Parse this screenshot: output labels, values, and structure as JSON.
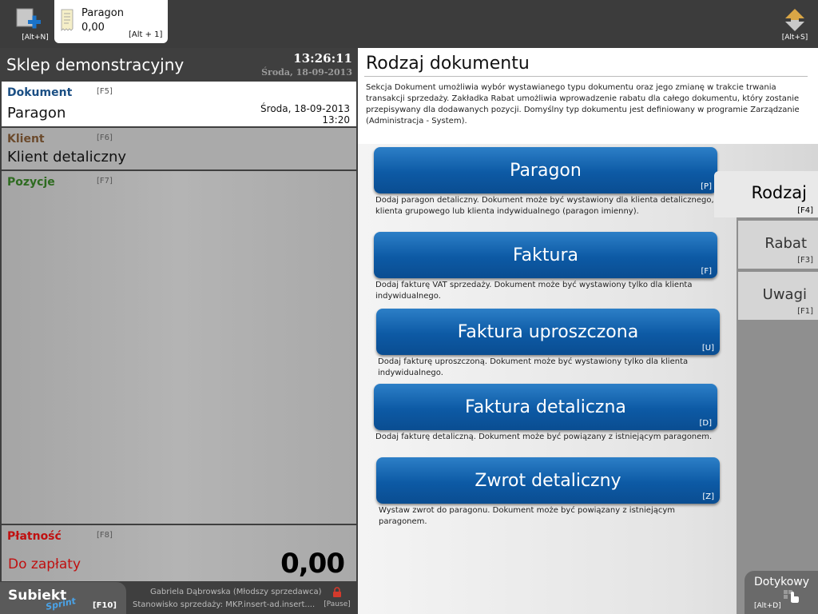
{
  "topbar": {
    "new_kbd": "[Alt+N]",
    "doc_tab": {
      "name": "Paragon",
      "amount": "0,00",
      "kbd": "[Alt + 1]"
    },
    "switch_kbd": "[Alt+S]"
  },
  "store": {
    "name": "Sklep demonstracyjny",
    "time": "13:26:11",
    "date": "Środa, 18-09-2013"
  },
  "sections": {
    "document": {
      "title": "Dokument",
      "key": "[F5]",
      "value": "Paragon",
      "date": "Środa, 18-09-2013",
      "time": "13:20"
    },
    "client": {
      "title": "Klient",
      "key": "[F6]",
      "value": "Klient detaliczny"
    },
    "items": {
      "title": "Pozycje",
      "key": "[F7]"
    },
    "payment": {
      "title": "Płatność",
      "key": "[F8]",
      "label": "Do zapłaty",
      "amount": "0,00"
    }
  },
  "status": {
    "logo": "Subiekt",
    "logo_sub": "Sprint",
    "logo_kbd": "[F10]",
    "user": "Gabriela Dąbrowska (Młodszy sprzedawca)",
    "station": "Stanowisko sprzedaży: MKP.insert-ad.insert....",
    "pause_kbd": "[Pause]"
  },
  "panel": {
    "title": "Rodzaj dokumentu",
    "description": "Sekcja Dokument umożliwia wybór wystawianego typu dokumentu oraz jego zmianę w trakcie trwania transakcji sprzedaży. Zakładka Rabat umożliwia wprowadzenie rabatu dla całego dokumentu, który zostanie przepisywany dla dodawanych  pozycji. Domyślny typ dokumentu jest definiowany w programie Zarządzanie (Administracja - System).",
    "options": [
      {
        "label": "Paragon",
        "key": "[P]",
        "hint": "Dodaj paragon detaliczny. Dokument może być wystawiony dla klienta detalicznego, klienta grupowego lub klienta indywidualnego (paragon imienny)."
      },
      {
        "label": "Faktura",
        "key": "[F]",
        "hint": "Dodaj fakturę VAT sprzedaży. Dokument może być wystawiony tylko dla klienta indywidualnego."
      },
      {
        "label": "Faktura uproszczona",
        "key": "[U]",
        "hint": "Dodaj fakturę uproszczoną. Dokument może być wystawiony tylko dla klienta indywidualnego."
      },
      {
        "label": "Faktura detaliczna",
        "key": "[D]",
        "hint": "Dodaj fakturę detaliczną. Dokument może być powiązany z istniejącym paragonem."
      },
      {
        "label": "Zwrot detaliczny",
        "key": "[Z]",
        "hint": "Wystaw zwrot do paragonu. Dokument może być powiązany z istniejącym paragonem."
      }
    ],
    "tabs": [
      {
        "label": "Rodzaj",
        "key": "[F4]"
      },
      {
        "label": "Rabat",
        "key": "[F3]"
      },
      {
        "label": "Uwagi",
        "key": "[F1]"
      }
    ],
    "touch": {
      "label": "Dotykowy",
      "key": "[Alt+D]"
    }
  },
  "colors": {
    "accent": "#0d5aa5",
    "document_title": "#1b4f84",
    "client_title": "#6b4a2c",
    "items_title": "#2e6b20",
    "payment_title": "#c01010"
  }
}
